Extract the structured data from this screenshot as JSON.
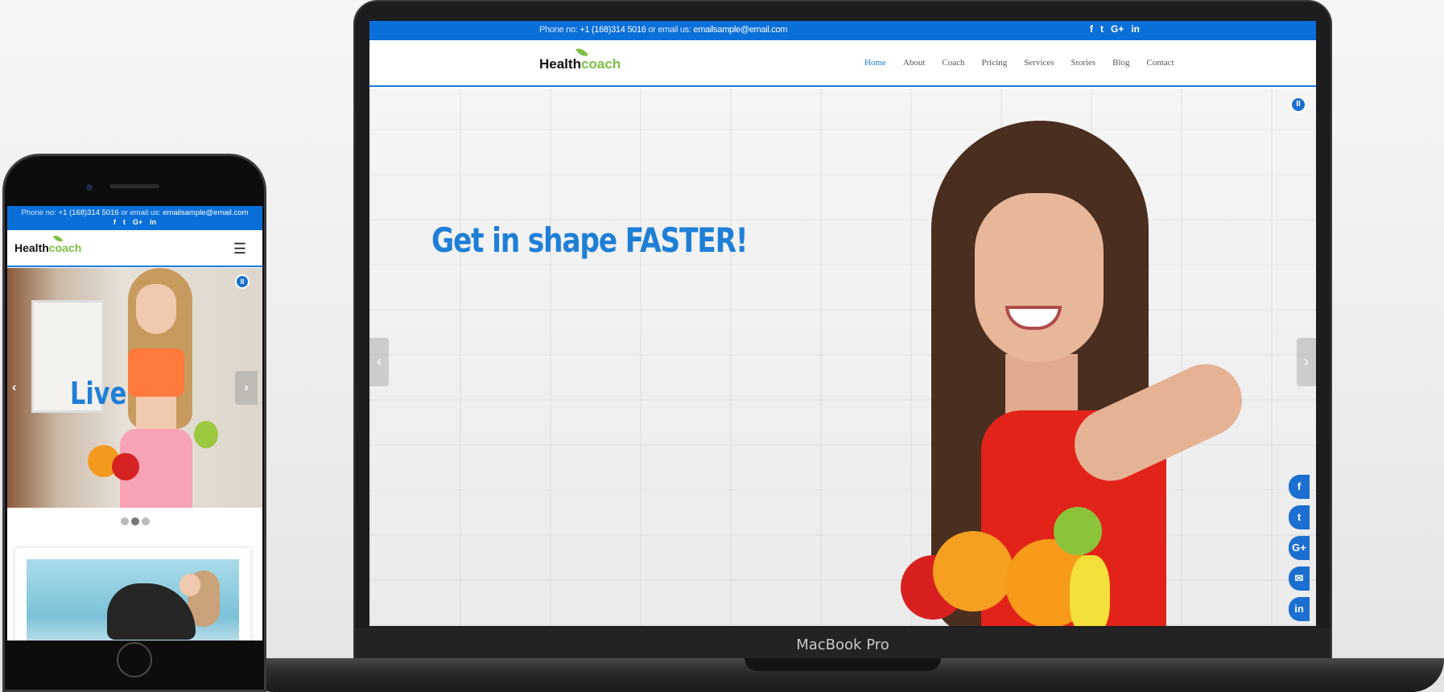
{
  "laptop": {
    "device_label": "MacBook Pro",
    "site": {
      "topbar": {
        "phone_prefix": "Phone no:",
        "phone": "+1 (168)314 5016",
        "email_prefix": "or email us:",
        "email": "emailsample@email.com",
        "social": [
          "f",
          "t",
          "G+",
          "in"
        ]
      },
      "logo": {
        "health": "Health",
        "coach": "coach"
      },
      "nav": [
        "Home",
        "About",
        "Coach",
        "Pricing",
        "Services",
        "Stories",
        "Blog",
        "Contact"
      ],
      "hero": {
        "headline": "Get in shape FASTER!",
        "pause": "II",
        "prev": "‹",
        "next": "›"
      },
      "share": [
        "f",
        "t",
        "G+",
        "✉",
        "in"
      ]
    }
  },
  "phone": {
    "site": {
      "topbar": {
        "phone_prefix": "Phone no:",
        "phone": "+1 (168)314 5016",
        "email_prefix": "or email us:",
        "email": "emailsample@email.com",
        "social": [
          "f",
          "t",
          "G+",
          "in"
        ]
      },
      "logo": {
        "health": "Health",
        "coach": "coach"
      },
      "menu_icon": "☰",
      "hero": {
        "headline": "Live",
        "pause": "II",
        "prev": "‹",
        "next": "›"
      },
      "dots": 3,
      "active_dot": 1
    }
  },
  "colors": {
    "brand_blue": "#0a6fd8",
    "headline_blue": "#1f7fd6",
    "leaf_green": "#7cc043"
  }
}
